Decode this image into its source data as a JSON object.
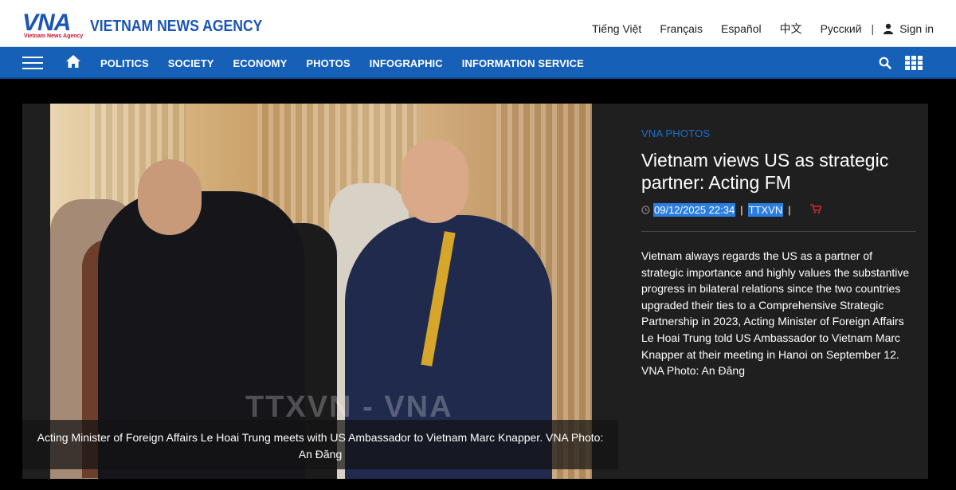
{
  "brand": {
    "logo_text": "VNA",
    "logo_subtitle": "Vietnam News Agency",
    "agency_name": "VIETNAM NEWS AGENCY"
  },
  "languages": [
    "Tiếng Việt",
    "Français",
    "Español",
    "中文",
    "Русский"
  ],
  "signin_label": "Sign in",
  "nav": {
    "items": [
      "POLITICS",
      "SOCIETY",
      "ECONOMY",
      "PHOTOS",
      "INFOGRAPHIC",
      "INFORMATION SERVICE"
    ]
  },
  "article": {
    "category": "VNA PHOTOS",
    "title": "Vietnam views US as strategic partner: Acting FM",
    "datetime": "09/12/2025 22:34",
    "source": "TTXVN",
    "summary": "Vietnam always regards the US as a partner of strategic importance and highly values the substantive progress in bilateral relations since the two countries upgraded their ties to a Comprehensive Strategic Partnership in 2023, Acting Minister of Foreign Affairs Le Hoai Trung told US Ambassador to Vietnam Marc Knapper at their meeting in Hanoi on September 12. VNA Photo: An Đăng",
    "photo_caption": "Acting Minister of Foreign Affairs Le Hoai Trung meets with US Ambassador to Vietnam Marc Knapper. VNA Photo: An Đăng",
    "watermark": "TTXVN - VNA"
  },
  "colors": {
    "brand_blue": "#1760b8",
    "brand_red": "#c8102e",
    "category_blue": "#1a6fd0",
    "selection_highlight": "#2a7de1"
  },
  "icons": [
    "hamburger-icon",
    "home-icon",
    "search-icon",
    "grid-icon",
    "user-icon",
    "clock-icon",
    "cart-icon"
  ]
}
